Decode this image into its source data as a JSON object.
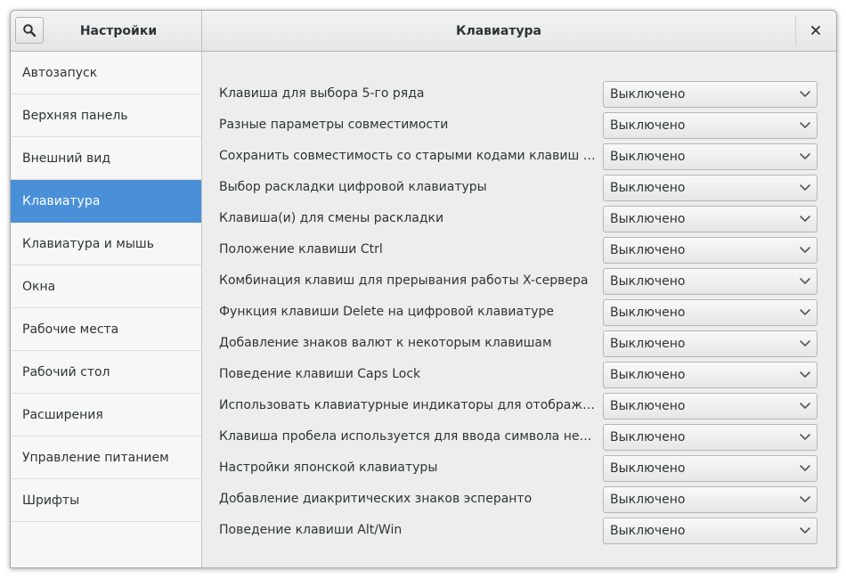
{
  "header": {
    "left_title": "Настройки",
    "right_title": "Клавиатура",
    "close_label": "×"
  },
  "icons": {
    "search": "search-icon",
    "close": "close-icon",
    "dropdown": "chevron-down-icon"
  },
  "colors": {
    "accent": "#4a90d9",
    "text": "#2e3436",
    "sidebar_bg": "#f7f7f7",
    "content_bg": "#ededed"
  },
  "sidebar": {
    "selected_index": 3,
    "items": [
      {
        "label": "Автозапуск"
      },
      {
        "label": "Верхняя панель"
      },
      {
        "label": "Внешний вид"
      },
      {
        "label": "Клавиатура"
      },
      {
        "label": "Клавиатура и мышь"
      },
      {
        "label": "Окна"
      },
      {
        "label": "Рабочие места"
      },
      {
        "label": "Рабочий стол"
      },
      {
        "label": "Расширения"
      },
      {
        "label": "Управление питанием"
      },
      {
        "label": "Шрифты"
      }
    ]
  },
  "settings": [
    {
      "label": "Клавиша для выбора 5-го ряда",
      "value": "Выключено"
    },
    {
      "label": "Разные параметры совместимости",
      "value": "Выключено"
    },
    {
      "label": "Сохранить совместимость со старыми кодами клавиш Solaris",
      "value": "Выключено"
    },
    {
      "label": "Выбор раскладки цифровой клавиатуры",
      "value": "Выключено"
    },
    {
      "label": "Клавиша(и) для смены раскладки",
      "value": "Выключено"
    },
    {
      "label": "Положение клавиши Ctrl",
      "value": "Выключено"
    },
    {
      "label": "Комбинация клавиш для прерывания работы X-сервера",
      "value": "Выключено"
    },
    {
      "label": "Функция клавиши Delete на цифровой клавиатуре",
      "value": "Выключено"
    },
    {
      "label": "Добавление знаков валют к некоторым клавишам",
      "value": "Выключено"
    },
    {
      "label": "Поведение клавиши Caps Lock",
      "value": "Выключено"
    },
    {
      "label": "Использовать клавиатурные индикаторы для отображения д…",
      "value": "Выключено"
    },
    {
      "label": "Клавиша пробела используется для ввода символа неразрыв…",
      "value": "Выключено"
    },
    {
      "label": "Настройки японской клавиатуры",
      "value": "Выключено"
    },
    {
      "label": "Добавление диакритических знаков эсперанто",
      "value": "Выключено"
    },
    {
      "label": "Поведение клавиши Alt/Win",
      "value": "Выключено"
    }
  ]
}
